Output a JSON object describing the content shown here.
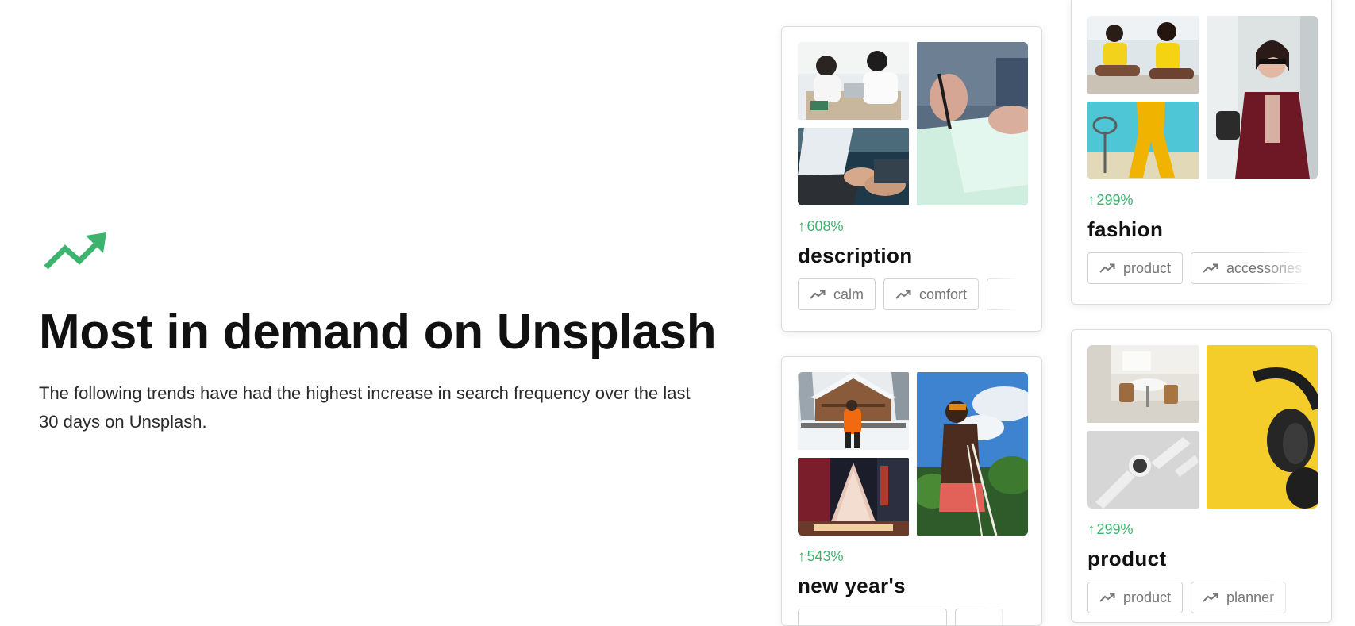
{
  "page": {
    "trend_icon": "trending-up-icon",
    "accent_color": "#3cb46e",
    "title": "Most in demand on Unsplash",
    "description": "The following trends have had the highest increase in search frequency over the last 30 days on Unsplash."
  },
  "cards": [
    {
      "topic": "description",
      "growth": "608%",
      "growth_arrow": "↑",
      "images": [
        "office-meeting-laptop-photo",
        "typing-on-laptop-photo",
        "hand-writing-with-pen-photo"
      ],
      "tags": [
        {
          "label": "calm",
          "icon": "trending-up-icon"
        },
        {
          "label": "comfort",
          "icon": "trending-up-icon"
        },
        {
          "label": "",
          "icon": ""
        }
      ]
    },
    {
      "topic": "fashion",
      "growth": "299%",
      "growth_arrow": "↑",
      "images": [
        "women-in-yellow-outfits-photo",
        "yellow-pants-photo",
        "woman-in-burgundy-coat-photo"
      ],
      "tags": [
        {
          "label": "product",
          "icon": "trending-up-icon"
        },
        {
          "label": "accessories",
          "icon": "trending-up-icon"
        }
      ]
    },
    {
      "topic": "new year's",
      "growth": "543%",
      "growth_arrow": "↑",
      "images": [
        "snowy-cabin-photo",
        "radio-city-christmas-tree-photo",
        "man-at-beach-with-rope-photo"
      ],
      "tags": [
        {
          "label": "",
          "icon": ""
        },
        {
          "label": "",
          "icon": ""
        }
      ]
    },
    {
      "topic": "product",
      "growth": "299%",
      "growth_arrow": "↑",
      "images": [
        "dining-table-chairs-photo",
        "white-smartwatch-photo",
        "black-headphones-on-yellow-photo"
      ],
      "tags": [
        {
          "label": "product",
          "icon": "trending-up-icon"
        },
        {
          "label": "planner",
          "icon": "trending-up-icon"
        }
      ]
    }
  ]
}
